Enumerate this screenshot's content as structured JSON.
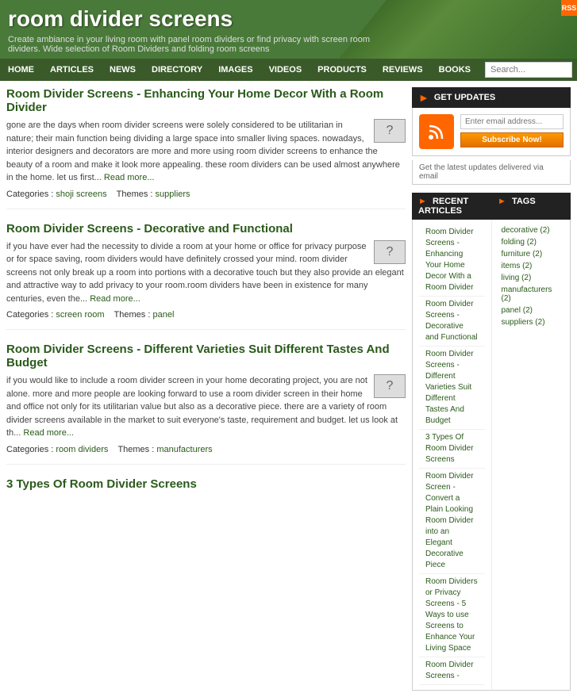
{
  "site": {
    "title": "room divider screens",
    "description": "Create ambiance in your living room with panel room dividers or find privacy with screen room dividers. Wide selection of Room Dividers and folding room screens"
  },
  "nav": {
    "items": [
      "HOME",
      "ARTICLES",
      "NEWS",
      "DIRECTORY",
      "IMAGES",
      "VIDEOS",
      "PRODUCTS",
      "REVIEWS",
      "BOOKS"
    ],
    "search_placeholder": "Search..."
  },
  "articles": [
    {
      "title": "Room Divider Screens - Enhancing Your Home Decor With a Room Divider",
      "body": "gone are the days when room divider screens were solely considered to be utilitarian in nature; their main function being dividing a large space into smaller living spaces. nowadays, interior designers and decorators are more and more using room divider screens to enhance the beauty of a room and make it look more appealing. these room dividers can be used almost anywhere in the home. let us first...",
      "read_more": "Read more...",
      "categories_label": "Categories :",
      "categories": "shoji screens",
      "themes_label": "Themes :",
      "themes": "suppliers"
    },
    {
      "title": "Room Divider Screens - Decorative and Functional",
      "body": "if you have ever had the necessity to divide a room at your home or office for privacy purpose or for space saving, room dividers would have definitely crossed your mind. room divider screens not only break up a room into portions with a decorative touch but they also provide an elegant and attractive way to add privacy to your room.room dividers have been in existence for many centuries, even the...",
      "read_more": "Read more...",
      "categories_label": "Categories :",
      "categories": "screen room",
      "themes_label": "Themes :",
      "themes": "panel"
    },
    {
      "title": "Room Divider Screens - Different Varieties Suit Different Tastes And Budget",
      "body": "if you would like to include a room divider screen in your home decorating project, you are not alone. more and more people are looking forward to use a room divider screen in their home and office not only for its utilitarian value but also as a decorative piece. there are a variety of room divider screens available in the market to suit everyone's taste, requirement and budget. let us look at th...",
      "read_more": "Read more...",
      "categories_label": "Categories :",
      "categories": "room dividers",
      "themes_label": "Themes :",
      "themes": "manufacturers"
    },
    {
      "title": "3 Types Of Room Divider Screens",
      "body": "",
      "read_more": "",
      "categories_label": "",
      "categories": "",
      "themes_label": "",
      "themes": ""
    }
  ],
  "sidebar": {
    "updates": {
      "header": "GET UPDATES",
      "email_placeholder": "Enter email address...",
      "subscribe_label": "Subscribe Now!",
      "note": "Get the latest updates delivered via email"
    },
    "recent_articles_header": "RECENT ARTICLES",
    "tags_header": "TAGS",
    "recent_items": [
      "Room Divider Screens - Enhancing Your Home Decor With a Room Divider",
      "Room Divider Screens - Decorative and Functional",
      "Room Divider Screens - Different Varieties Suit Different Tastes And Budget",
      "3 Types Of Room Divider Screens",
      "Room Divider Screen - Convert a Plain Looking Room Divider into an Elegant Decorative Piece",
      "Room Dividers or Privacy Screens - 5 Ways to use Screens to Enhance Your Living Space",
      "Room Divider Screens -"
    ],
    "tags": [
      {
        "label": "decorative",
        "count": "(2)"
      },
      {
        "label": "folding",
        "count": "(2)"
      },
      {
        "label": "furniture",
        "count": "(2)"
      },
      {
        "label": "items",
        "count": "(2)"
      },
      {
        "label": "living",
        "count": "(2)"
      },
      {
        "label": "manufacturers",
        "count": "(2)"
      },
      {
        "label": "panel",
        "count": "(2)"
      },
      {
        "label": "suppliers",
        "count": "(2)"
      }
    ]
  }
}
